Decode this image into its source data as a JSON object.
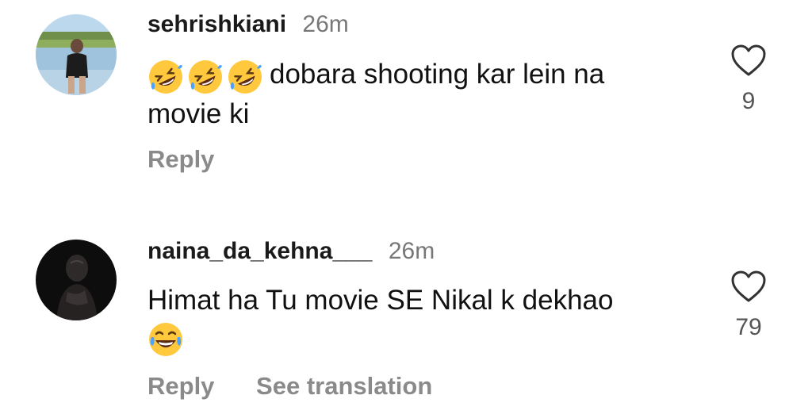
{
  "comments": [
    {
      "username": "sehrishkiani",
      "time": "26m",
      "emojis": [
        "rolling-on-floor-laughing",
        "rolling-on-floor-laughing",
        "rolling-on-floor-laughing"
      ],
      "text_line1": "dobara shooting kar lein na",
      "text_line2": "movie ki",
      "likes": "9",
      "reply_label": "Reply"
    },
    {
      "username": "naina_da_kehna___",
      "time": "26m",
      "text": "Himat ha Tu movie SE Nikal k dekhao",
      "trailing_emoji": "face-with-tears-of-joy",
      "likes": "79",
      "reply_label": "Reply",
      "translate_label": "See translation"
    }
  ],
  "colors": {
    "text": "#111111",
    "secondary": "#777777",
    "action": "#8a8a8a",
    "emoji_face": "#FFC83D"
  }
}
